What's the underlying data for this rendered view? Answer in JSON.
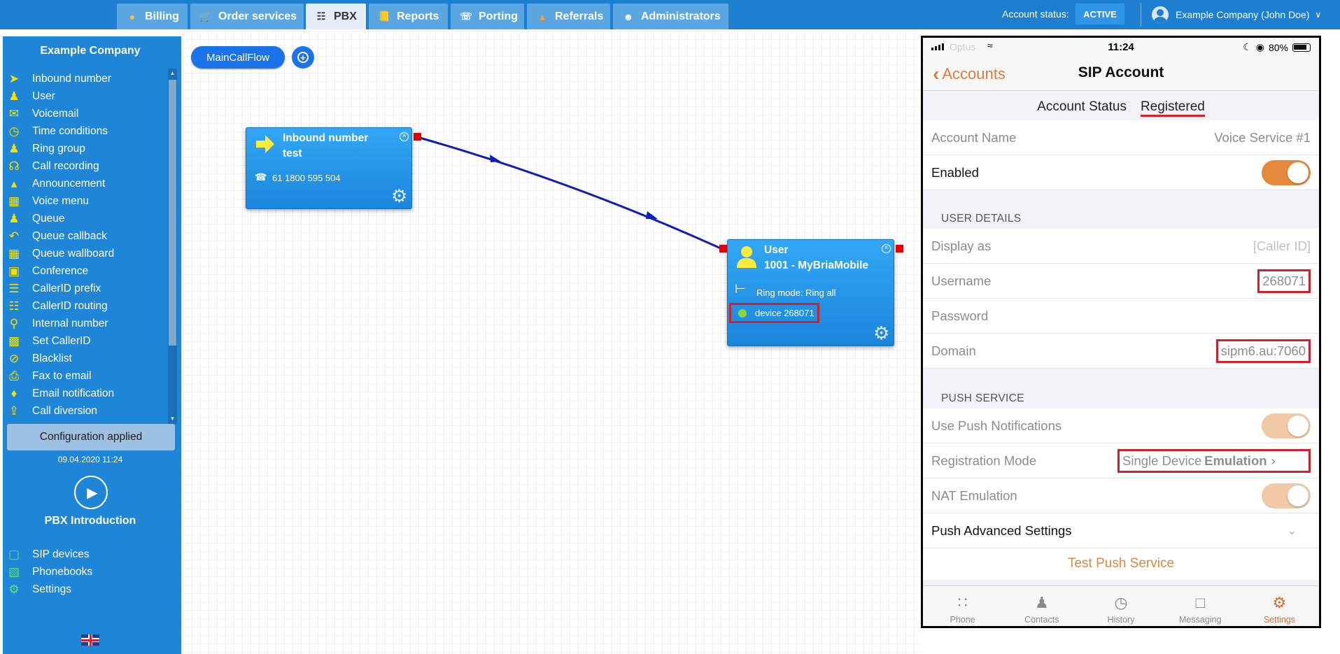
{
  "topbar": {
    "tabs": [
      {
        "label": "Billing",
        "icon": "coins-icon"
      },
      {
        "label": "Order services",
        "icon": "cart-icon"
      },
      {
        "label": "PBX",
        "icon": "pbx-icon",
        "active": true
      },
      {
        "label": "Reports",
        "icon": "report-icon"
      },
      {
        "label": "Porting",
        "icon": "phone-port-icon"
      },
      {
        "label": "Referrals",
        "icon": "referral-icon"
      },
      {
        "label": "Administrators",
        "icon": "admin-icon"
      }
    ],
    "account_status_label": "Account status:",
    "account_status_value": "ACTIVE",
    "user_name": "Example Company (John Doe)"
  },
  "sidebar": {
    "company": "Example Company",
    "items": [
      {
        "label": "Inbound number",
        "icon": "arrow-right-icon"
      },
      {
        "label": "User",
        "icon": "user-icon"
      },
      {
        "label": "Voicemail",
        "icon": "envelope-icon"
      },
      {
        "label": "Time conditions",
        "icon": "clock-icon"
      },
      {
        "label": "Ring group",
        "icon": "group-icon"
      },
      {
        "label": "Call recording",
        "icon": "microphone-icon"
      },
      {
        "label": "Announcement",
        "icon": "megaphone-icon"
      },
      {
        "label": "Voice menu",
        "icon": "grid-icon"
      },
      {
        "label": "Queue",
        "icon": "user-plus-icon"
      },
      {
        "label": "Queue callback",
        "icon": "reply-icon"
      },
      {
        "label": "Queue wallboard",
        "icon": "table-icon"
      },
      {
        "label": "Conference",
        "icon": "chat-icon"
      },
      {
        "label": "CallerID prefix",
        "icon": "list-icon"
      },
      {
        "label": "CallerID routing",
        "icon": "sitemap-icon"
      },
      {
        "label": "Internal number",
        "icon": "pin-icon"
      },
      {
        "label": "Set CallerID",
        "icon": "id-card-icon"
      },
      {
        "label": "Blacklist",
        "icon": "ban-icon"
      },
      {
        "label": "Fax to email",
        "icon": "fax-icon"
      },
      {
        "label": "Email notification",
        "icon": "bell-icon"
      },
      {
        "label": "Call diversion",
        "icon": "upload-icon"
      }
    ],
    "config_status": "Configuration applied",
    "config_date": "09.04.2020 11:24",
    "intro_label": "PBX Introduction",
    "bottom_items": [
      {
        "label": "SIP devices",
        "icon": "monitor-icon"
      },
      {
        "label": "Phonebooks",
        "icon": "book-icon"
      },
      {
        "label": "Settings",
        "icon": "gear-icon"
      }
    ],
    "language": "UK flag"
  },
  "canvas": {
    "flow_name": "MainCallFlow",
    "inbound_node": {
      "title_line1": "Inbound number",
      "title_line2": "test",
      "number": "61 1800 595 504"
    },
    "user_node": {
      "title_line1": "User",
      "title_line2": "1001 - MyBriaMobile",
      "ring_mode": "Ring mode: Ring all",
      "device": "device 268071"
    }
  },
  "phone": {
    "status": {
      "time": "11:24",
      "battery": "80%",
      "carrier": "Optus"
    },
    "nav": {
      "back_label": "Accounts",
      "title": "SIP Account"
    },
    "account_status_label": "Account Status",
    "account_status_value": "Registered",
    "account_name_label": "Account Name",
    "account_name_value": "Voice Service #1",
    "enabled_label": "Enabled",
    "user_details_header": "USER DETAILS",
    "display_as_label": "Display as",
    "display_as_placeholder": "[Caller ID]",
    "username_label": "Username",
    "username_value": "268071",
    "password_label": "Password",
    "domain_label": "Domain",
    "domain_value": "sipm6.au:7060",
    "push_service_header": "PUSH SERVICE",
    "use_push_label": "Use Push Notifications",
    "registration_mode_label": "Registration Mode",
    "registration_mode_value_a": "Single Device",
    "registration_mode_value_b": "Emulation",
    "nat_emulation_label": "NAT Emulation",
    "push_advanced_label": "Push Advanced Settings",
    "test_push_label": "Test Push Service",
    "tabs": [
      {
        "label": "Phone",
        "icon": "keypad-icon"
      },
      {
        "label": "Contacts",
        "icon": "contact-icon"
      },
      {
        "label": "History",
        "icon": "history-icon"
      },
      {
        "label": "Messaging",
        "icon": "message-icon"
      },
      {
        "label": "Settings",
        "icon": "gear-icon",
        "active": true
      }
    ]
  },
  "colors": {
    "accent": "#1e7fd1",
    "sidebar": "#1e85d7",
    "orange": "#e4893b",
    "highlight_red": "#d0202a"
  }
}
